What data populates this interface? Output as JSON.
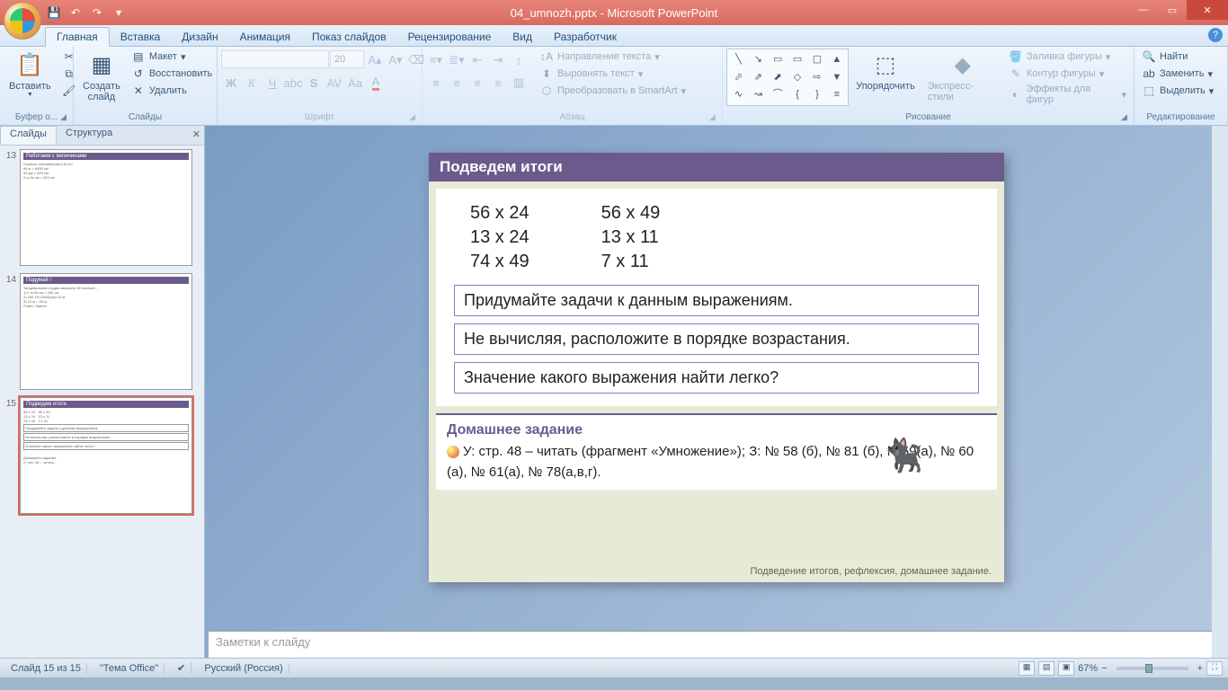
{
  "app": {
    "title": "04_umnozh.pptx - Microsoft PowerPoint"
  },
  "tabs": {
    "items": [
      "Главная",
      "Вставка",
      "Дизайн",
      "Анимация",
      "Показ слайдов",
      "Рецензирование",
      "Вид",
      "Разработчик"
    ],
    "active": 0
  },
  "ribbon": {
    "clipboard": {
      "title": "Буфер о...",
      "paste": "Вставить"
    },
    "slides": {
      "title": "Слайды",
      "new": "Создать\nслайд",
      "layout": "Макет",
      "reset": "Восстановить",
      "delete": "Удалить"
    },
    "font": {
      "title": "Шрифт",
      "size": "20"
    },
    "paragraph": {
      "title": "Абзац",
      "textdir": "Направление текста",
      "align": "Выровнять текст",
      "smartart": "Преобразовать в SmartArt"
    },
    "drawing": {
      "title": "Рисование",
      "arrange": "Упорядочить",
      "quick": "Экспресс-стили",
      "fill": "Заливка фигуры",
      "outline": "Контур фигуры",
      "effects": "Эффекты для фигур"
    },
    "editing": {
      "title": "Редактирование",
      "find": "Найти",
      "replace": "Заменить",
      "select": "Выделить"
    }
  },
  "panel": {
    "tab_slides": "Слайды",
    "tab_outline": "Структура",
    "thumbs": [
      {
        "num": "13",
        "title": "Работаем с величинами"
      },
      {
        "num": "14",
        "title": "Подумай !"
      },
      {
        "num": "15",
        "title": "Подведем итоги"
      }
    ]
  },
  "slide": {
    "title": "Подведем итоги",
    "exprs_left": [
      "56 х 24",
      "13 х 24",
      "74 х 49"
    ],
    "exprs_right": [
      "56 х 49",
      "13 х 11",
      "7 х 11"
    ],
    "task1": "Придумайте задачи к данным выражениям.",
    "task2": "Не вычисляя, расположите в порядке возрастания.",
    "task3": "Значение какого выражения найти легко?",
    "hw_title": "Домашнее задание",
    "hw_text": "У: стр. 48 – читать (фрагмент «Умножение»); З: № 58 (б), № 81 (б), №59(а), № 60 (а), № 61(а), № 78(а,в,г).",
    "footer": "Подведение итогов, рефлексия,  домашнее задание."
  },
  "notes": {
    "placeholder": "Заметки к слайду"
  },
  "status": {
    "slide": "Слайд 15 из 15",
    "theme": "\"Тема Office\"",
    "lang": "Русский (Россия)",
    "zoom": "67%"
  }
}
